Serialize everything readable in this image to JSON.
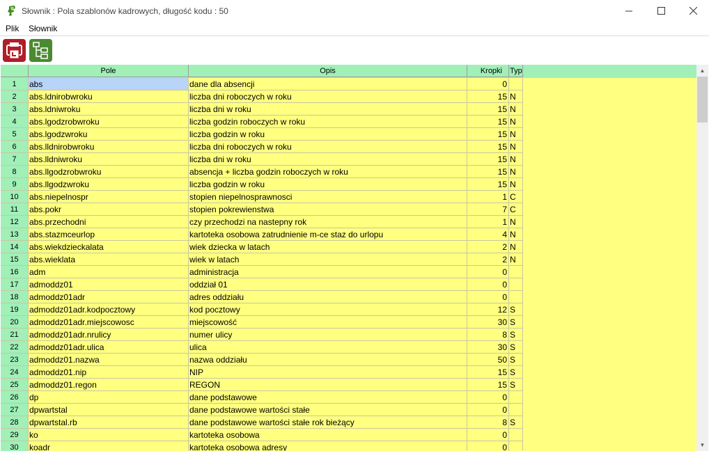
{
  "window": {
    "title": "Słownik : Pola szablonów kadrowych,  długość kodu : 50",
    "minimize": "—",
    "maximize": "☐",
    "close": "✕"
  },
  "menu": [
    "Plik",
    "Słownik"
  ],
  "toolbar": {
    "buttons": [
      {
        "name": "print-button",
        "icon": "printer-icon",
        "color": "#b01e28"
      },
      {
        "name": "tree-button",
        "icon": "tree-icon",
        "color": "#4a8a30"
      }
    ]
  },
  "grid": {
    "columns": [
      "Pole",
      "Opis",
      "Kropki",
      "Typ"
    ],
    "header_color": "#a0f0b8",
    "row_color": "#ffff80",
    "rows": [
      {
        "num": "1",
        "pole": "abs",
        "opis": "dane dla absencji",
        "kropki": "0",
        "typ": ""
      },
      {
        "num": "2",
        "pole": "abs.ldnirobwroku",
        "opis": "liczba dni roboczych w roku",
        "kropki": "15",
        "typ": "N"
      },
      {
        "num": "3",
        "pole": "abs.ldniwroku",
        "opis": "liczba dni w roku",
        "kropki": "15",
        "typ": "N"
      },
      {
        "num": "4",
        "pole": "abs.lgodzrobwroku",
        "opis": "liczba godzin roboczych w roku",
        "kropki": "15",
        "typ": "N"
      },
      {
        "num": "5",
        "pole": "abs.lgodzwroku",
        "opis": "liczba godzin w roku",
        "kropki": "15",
        "typ": "N"
      },
      {
        "num": "6",
        "pole": "abs.lldnirobwroku",
        "opis": "liczba dni roboczych w roku",
        "kropki": "15",
        "typ": "N"
      },
      {
        "num": "7",
        "pole": "abs.lldniwroku",
        "opis": "liczba dni w roku",
        "kropki": "15",
        "typ": "N"
      },
      {
        "num": "8",
        "pole": "abs.llgodzrobwroku",
        "opis": "absencja + liczba godzin roboczych w roku",
        "kropki": "15",
        "typ": "N"
      },
      {
        "num": "9",
        "pole": "abs.llgodzwroku",
        "opis": "liczba godzin w roku",
        "kropki": "15",
        "typ": "N"
      },
      {
        "num": "10",
        "pole": "abs.niepelnospr",
        "opis": "stopien niepelnosprawnosci",
        "kropki": "1",
        "typ": "C"
      },
      {
        "num": "11",
        "pole": "abs.pokr",
        "opis": "stopien pokrewienstwa",
        "kropki": "7",
        "typ": "C"
      },
      {
        "num": "12",
        "pole": "abs.przechodni",
        "opis": "czy przechodzi na nastepny rok",
        "kropki": "1",
        "typ": "N"
      },
      {
        "num": "13",
        "pole": "abs.stazmceurlop",
        "opis": "kartoteka osobowa zatrudnienie m-ce staz do urlopu",
        "kropki": "4",
        "typ": "N"
      },
      {
        "num": "14",
        "pole": "abs.wiekdzieckalata",
        "opis": "wiek dziecka w latach",
        "kropki": "2",
        "typ": "N"
      },
      {
        "num": "15",
        "pole": "abs.wieklata",
        "opis": "wiek w latach",
        "kropki": "2",
        "typ": "N"
      },
      {
        "num": "16",
        "pole": "adm",
        "opis": "administracja",
        "kropki": "0",
        "typ": ""
      },
      {
        "num": "17",
        "pole": "admoddz01",
        "opis": "oddział 01",
        "kropki": "0",
        "typ": ""
      },
      {
        "num": "18",
        "pole": "admoddz01adr",
        "opis": "adres oddziału",
        "kropki": "0",
        "typ": ""
      },
      {
        "num": "19",
        "pole": "admoddz01adr.kodpocztowy",
        "opis": "kod pocztowy",
        "kropki": "12",
        "typ": "S"
      },
      {
        "num": "20",
        "pole": "admoddz01adr.miejscowosc",
        "opis": "miejscowość",
        "kropki": "30",
        "typ": "S"
      },
      {
        "num": "21",
        "pole": "admoddz01adr.nrulicy",
        "opis": "numer ulicy",
        "kropki": "8",
        "typ": "S"
      },
      {
        "num": "22",
        "pole": "admoddz01adr.ulica",
        "opis": "ulica",
        "kropki": "30",
        "typ": "S"
      },
      {
        "num": "23",
        "pole": "admoddz01.nazwa",
        "opis": "nazwa oddziału",
        "kropki": "50",
        "typ": "S"
      },
      {
        "num": "24",
        "pole": "admoddz01.nip",
        "opis": "NIP",
        "kropki": "15",
        "typ": "S"
      },
      {
        "num": "25",
        "pole": "admoddz01.regon",
        "opis": "REGON",
        "kropki": "15",
        "typ": "S"
      },
      {
        "num": "26",
        "pole": "dp",
        "opis": "dane podstawowe",
        "kropki": "0",
        "typ": ""
      },
      {
        "num": "27",
        "pole": "dpwartstal",
        "opis": "dane podstawowe wartości stałe",
        "kropki": "0",
        "typ": ""
      },
      {
        "num": "28",
        "pole": "dpwartstal.rb",
        "opis": "dane podstawowe wartości stałe rok bieżący",
        "kropki": "8",
        "typ": "S"
      },
      {
        "num": "29",
        "pole": "ko",
        "opis": "kartoteka osobowa",
        "kropki": "0",
        "typ": ""
      },
      {
        "num": "30",
        "pole": "koadr",
        "opis": "kartoteka osobowa adresy",
        "kropki": "0",
        "typ": ""
      }
    ]
  }
}
